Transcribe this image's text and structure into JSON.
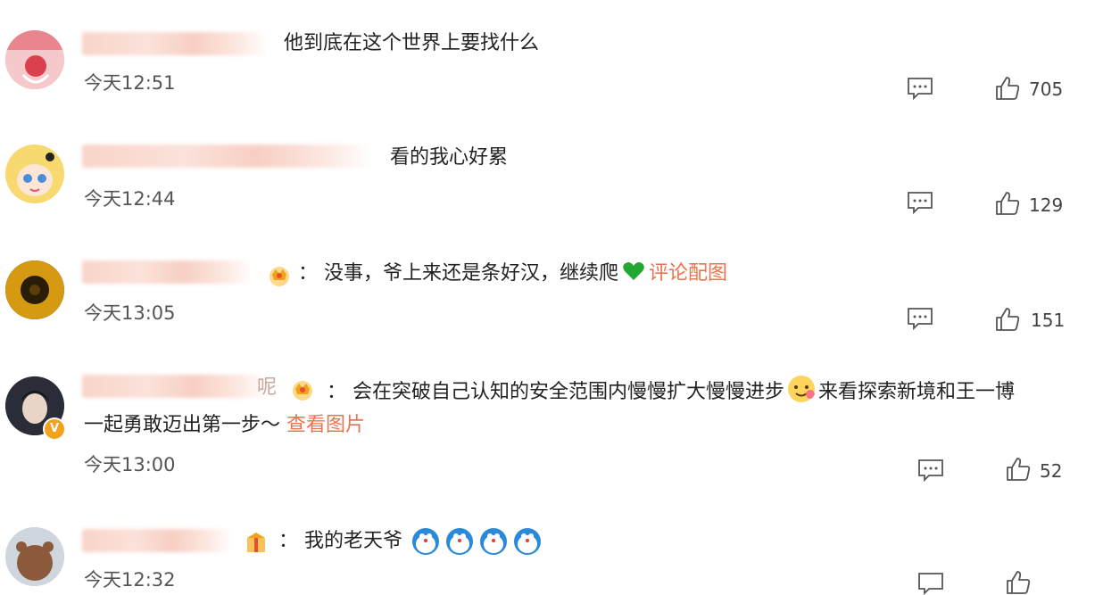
{
  "comments": [
    {
      "text": "他到底在这个世界上要找什么",
      "time": "今天12:51",
      "likes": "705"
    },
    {
      "text": "看的我心好累",
      "time": "今天12:44",
      "likes": "129"
    },
    {
      "prefix": "：",
      "text": "没事，爷上来还是条好汉，继续爬",
      "link": "评论配图",
      "time": "今天13:05",
      "likes": "151"
    },
    {
      "name_suffix": "呢",
      "prefix": "：",
      "text": "会在突破自己认知的安全范围内慢慢扩大慢慢进步",
      "text_after_emoji": "来看探索新境和王一博",
      "text_line2": "一起勇敢迈出第一步～",
      "link": "查看图片",
      "time": "今天13:00",
      "likes": "52",
      "verified_label": "V"
    },
    {
      "prefix": "：",
      "text": "我的老天爷",
      "time": "今天12:32"
    }
  ],
  "colors": {
    "link": "#eb7350",
    "text": "#222222",
    "muted": "#555555",
    "heart": "#22a832"
  },
  "icons": {
    "reply": "comment-bubble-icon",
    "like": "thumbs-up-icon"
  }
}
